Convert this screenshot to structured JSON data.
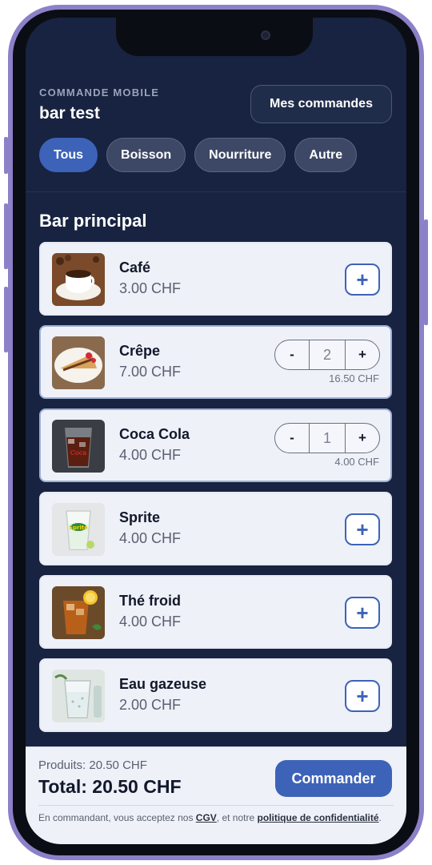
{
  "header": {
    "kicker": "COMMANDE MOBILE",
    "bar_name": "bar test",
    "orders_button": "Mes commandes",
    "chips": [
      "Tous",
      "Boisson",
      "Nourriture",
      "Autre"
    ],
    "active_chip": "Tous"
  },
  "section_title": "Bar principal",
  "items": [
    {
      "name": "Café",
      "price": "3.00 CHF",
      "image": "coffee-cup-image"
    },
    {
      "name": "Crêpe",
      "price": "7.00 CHF",
      "image": "crepe-image",
      "qty": "2",
      "line_total": "16.50 CHF",
      "minus": "-",
      "plus": "+"
    },
    {
      "name": "Coca Cola",
      "price": "4.00 CHF",
      "image": "cola-glass-image",
      "qty": "1",
      "line_total": "4.00 CHF",
      "minus": "-",
      "plus": "+"
    },
    {
      "name": "Sprite",
      "price": "4.00 CHF",
      "image": "sprite-glass-image"
    },
    {
      "name": "Thé froid",
      "price": "4.00 CHF",
      "image": "iced-tea-image"
    },
    {
      "name": "Eau gazeuse",
      "price": "2.00 CHF",
      "image": "sparkling-water-image"
    }
  ],
  "footer": {
    "products": "Produits: 20.50 CHF",
    "total": "Total: 20.50 CHF",
    "order_button": "Commander",
    "legal_prefix": "En commandant, vous acceptez nos ",
    "legal_cgv": "CGV",
    "legal_middle": ", et notre ",
    "legal_policy": "politique de confidentialité",
    "legal_suffix": "."
  },
  "colors": {
    "background": "#172340",
    "accent": "#3d63b8",
    "card": "#eef1f8",
    "frame": "#8c80c8"
  }
}
